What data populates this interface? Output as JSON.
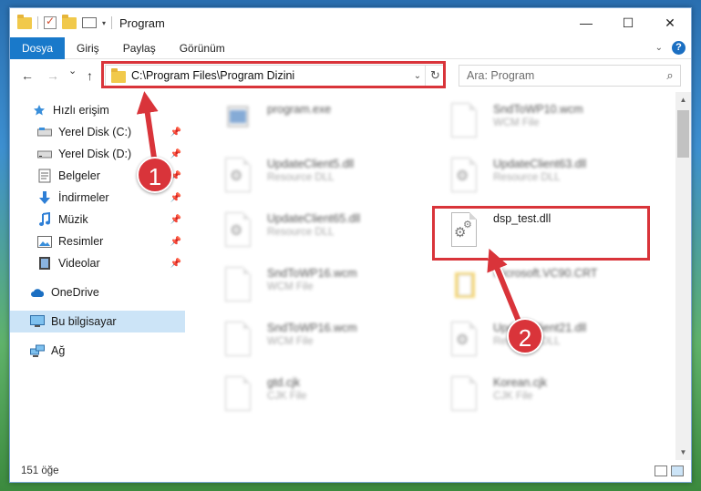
{
  "window": {
    "title": "Program",
    "controls": {
      "minimize": "—",
      "maximize": "☐",
      "close": "✕"
    }
  },
  "ribbon": {
    "tabs": [
      "Dosya",
      "Giriş",
      "Paylaş",
      "Görünüm"
    ],
    "active_tab": "Dosya",
    "help": "?"
  },
  "navigation": {
    "back": "←",
    "forward": "→",
    "recent": "⌄",
    "up": "↑",
    "address": "C:\\Program Files\\Program Dizini",
    "search_placeholder": "Ara: Program"
  },
  "sidebar": {
    "quick_access": "Hızlı erişim",
    "items": [
      {
        "label": "Yerel Disk (C:)",
        "icon": "drive-icon",
        "pinned": true
      },
      {
        "label": "Yerel Disk (D:)",
        "icon": "drive-icon",
        "pinned": true
      },
      {
        "label": "Belgeler",
        "icon": "documents-icon",
        "pinned": true
      },
      {
        "label": "İndirmeler",
        "icon": "download-icon",
        "pinned": true
      },
      {
        "label": "Müzik",
        "icon": "music-icon",
        "pinned": true
      },
      {
        "label": "Resimler",
        "icon": "pictures-icon",
        "pinned": true
      },
      {
        "label": "Videolar",
        "icon": "video-icon",
        "pinned": true
      }
    ],
    "onedrive": "OneDrive",
    "this_pc": "Bu bilgisayar",
    "network": "Ağ"
  },
  "files": [
    {
      "name": "program.exe",
      "type": "",
      "icon": "exe-icon",
      "blurred": true
    },
    {
      "name": "SndToWP10.wcm",
      "type": "WCM File",
      "icon": "document-icon",
      "blurred": true
    },
    {
      "name": "UpdateClient5.dll",
      "type": "Resource DLL",
      "icon": "dll-icon",
      "blurred": true
    },
    {
      "name": "UpdateClient63.dll",
      "type": "Resource DLL",
      "icon": "dll-icon",
      "blurred": true
    },
    {
      "name": "UpdateClient65.dll",
      "type": "Resource DLL",
      "icon": "dll-icon",
      "blurred": true
    },
    {
      "name": "dsp_test.dll",
      "type": "",
      "icon": "dll-icon",
      "blurred": false
    },
    {
      "name": "SndToWP16.wcm",
      "type": "WCM File",
      "icon": "document-icon",
      "blurred": true
    },
    {
      "name": "Microsoft.VC90.CRT",
      "type": "",
      "icon": "folder-icon",
      "blurred": true
    },
    {
      "name": "SndToWP16.wcm",
      "type": "WCM File",
      "icon": "document-icon",
      "blurred": true
    },
    {
      "name": "UpdateClient21.dll",
      "type": "Resource DLL",
      "icon": "dll-icon",
      "blurred": true
    },
    {
      "name": "gtd.cjk",
      "type": "CJK File",
      "icon": "document-icon",
      "blurred": true
    },
    {
      "name": "Korean.cjk",
      "type": "CJK File",
      "icon": "document-icon",
      "blurred": true
    }
  ],
  "status": {
    "item_count": "151 öğe"
  },
  "callouts": [
    "1",
    "2"
  ],
  "colors": {
    "accent": "#1979ca",
    "highlight": "#d9343a"
  }
}
